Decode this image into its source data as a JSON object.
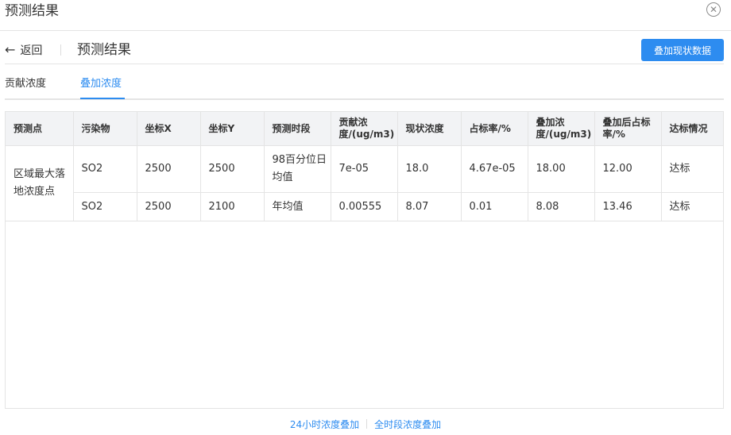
{
  "modal": {
    "title": "预测结果",
    "close_icon": "close-circle-icon"
  },
  "header": {
    "back_label": "返回",
    "back_icon": "arrow-left-icon",
    "page_title": "预测结果",
    "add_button_label": "叠加现状数据"
  },
  "tabs": [
    {
      "label": "贡献浓度",
      "active": false
    },
    {
      "label": "叠加浓度",
      "active": true
    }
  ],
  "table": {
    "columns": [
      "预测点",
      "污染物",
      "坐标X",
      "坐标Y",
      "预测时段",
      "贡献浓度/(ug/m3)",
      "现状浓度",
      "占标率/%",
      "叠加浓度/(ug/m3)",
      "叠加后占标率/%",
      "达标情况"
    ],
    "group_label": "区域最大落地浓度点",
    "rows": [
      {
        "pollutant": "SO2",
        "x": "2500",
        "y": "2500",
        "period": "98百分位日均值",
        "contrib": "7e-05",
        "current": "18.0",
        "ratio": "4.67e-05",
        "overlay": "18.00",
        "overlay_ratio": "12.00",
        "status": "达标"
      },
      {
        "pollutant": "SO2",
        "x": "2500",
        "y": "2100",
        "period": "年均值",
        "contrib": "0.00555",
        "current": "8.07",
        "ratio": "0.01",
        "overlay": "8.08",
        "overlay_ratio": "13.46",
        "status": "达标"
      }
    ]
  },
  "footer": {
    "link1": "24小时浓度叠加",
    "link2": "全时段浓度叠加"
  },
  "colors": {
    "accent": "#2d8cf0",
    "header_bg": "#f2f3f5",
    "border": "#e4e4e4"
  }
}
